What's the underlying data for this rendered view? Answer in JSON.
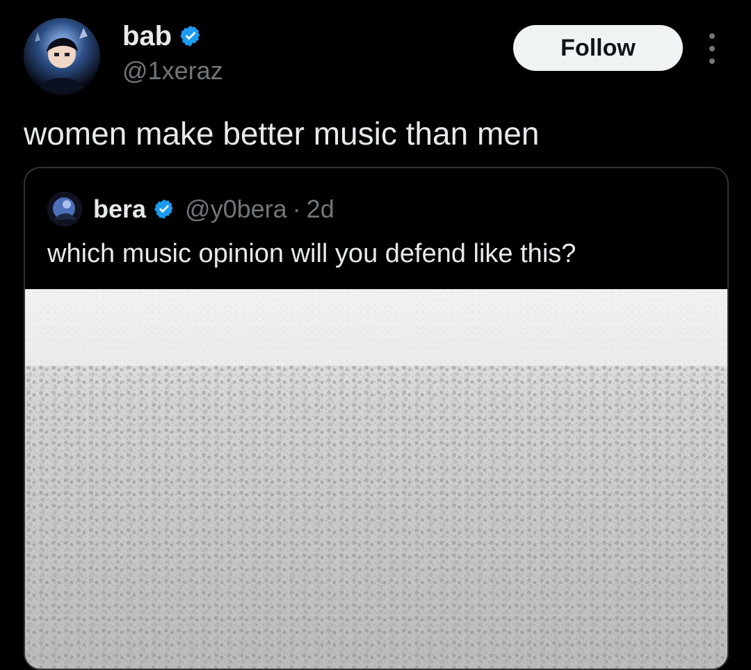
{
  "author": {
    "display_name": "bab",
    "handle": "@1xeraz",
    "verified": true,
    "avatar_icon": "profile-avatar"
  },
  "actions": {
    "follow_label": "Follow",
    "more_icon": "more-icon"
  },
  "tweet": {
    "text": "women make better music than men"
  },
  "quote": {
    "display_name": "bera",
    "handle": "@y0bera",
    "separator": "·",
    "time": "2d",
    "verified": true,
    "text": "which music opinion will you defend like this?",
    "media_icon": "crowd-image"
  },
  "colors": {
    "background": "#000000",
    "text_primary": "#e7e9ea",
    "text_secondary": "#71767b",
    "verified_badge": "#1d9bf0",
    "follow_bg": "#eff3f4",
    "card_border": "#2f3336"
  }
}
